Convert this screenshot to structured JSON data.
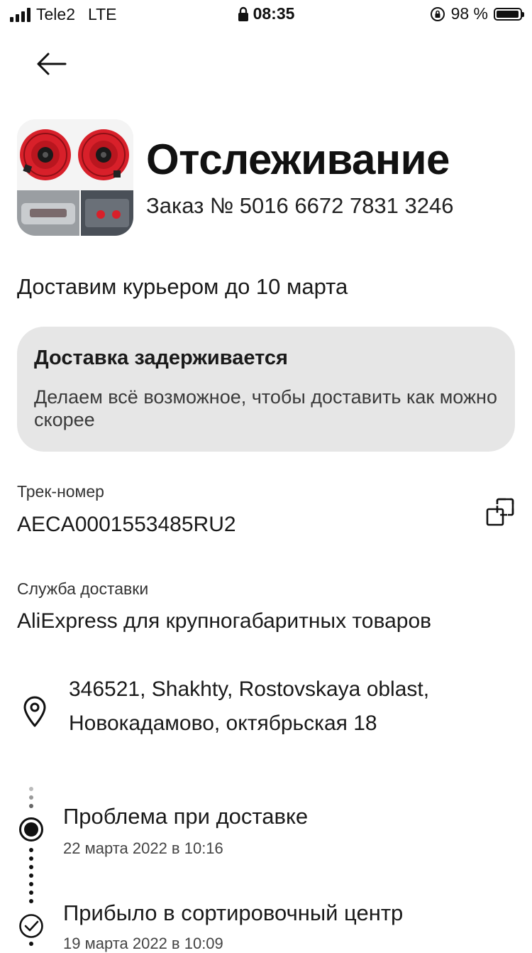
{
  "status_bar": {
    "carrier": "Tele2",
    "network": "LTE",
    "time": "08:35",
    "battery_percent": "98 %",
    "battery_level": 0.98
  },
  "header": {
    "title": "Отслеживание",
    "order_number": "Заказ № 5016 6672 7831 3246"
  },
  "delivery": {
    "eta": "Доставим курьером до 10 марта"
  },
  "delay_card": {
    "title": "Доставка задерживается",
    "text": "Делаем всё возможное, чтобы доставить как можно скорее"
  },
  "tracking": {
    "label": "Трек-номер",
    "number": "AECA0001553485RU2"
  },
  "service": {
    "label": "Служба доставки",
    "value": "AliExpress для крупногабаритных товаров"
  },
  "address": {
    "line1": "346521, Shakhty, Rostovskaya oblast,",
    "line2": "Новокадамово, октябрьская 18"
  },
  "timeline": [
    {
      "title": "Проблема при доставке",
      "date": "22 марта 2022 в 10:16"
    },
    {
      "title": "Прибыло в сортировочный центр",
      "date": "19 марта 2022 в 10:09"
    }
  ],
  "colors": {
    "text": "#141414",
    "card_bg": "#e6e6e6",
    "horn_red": "#d8202a"
  }
}
